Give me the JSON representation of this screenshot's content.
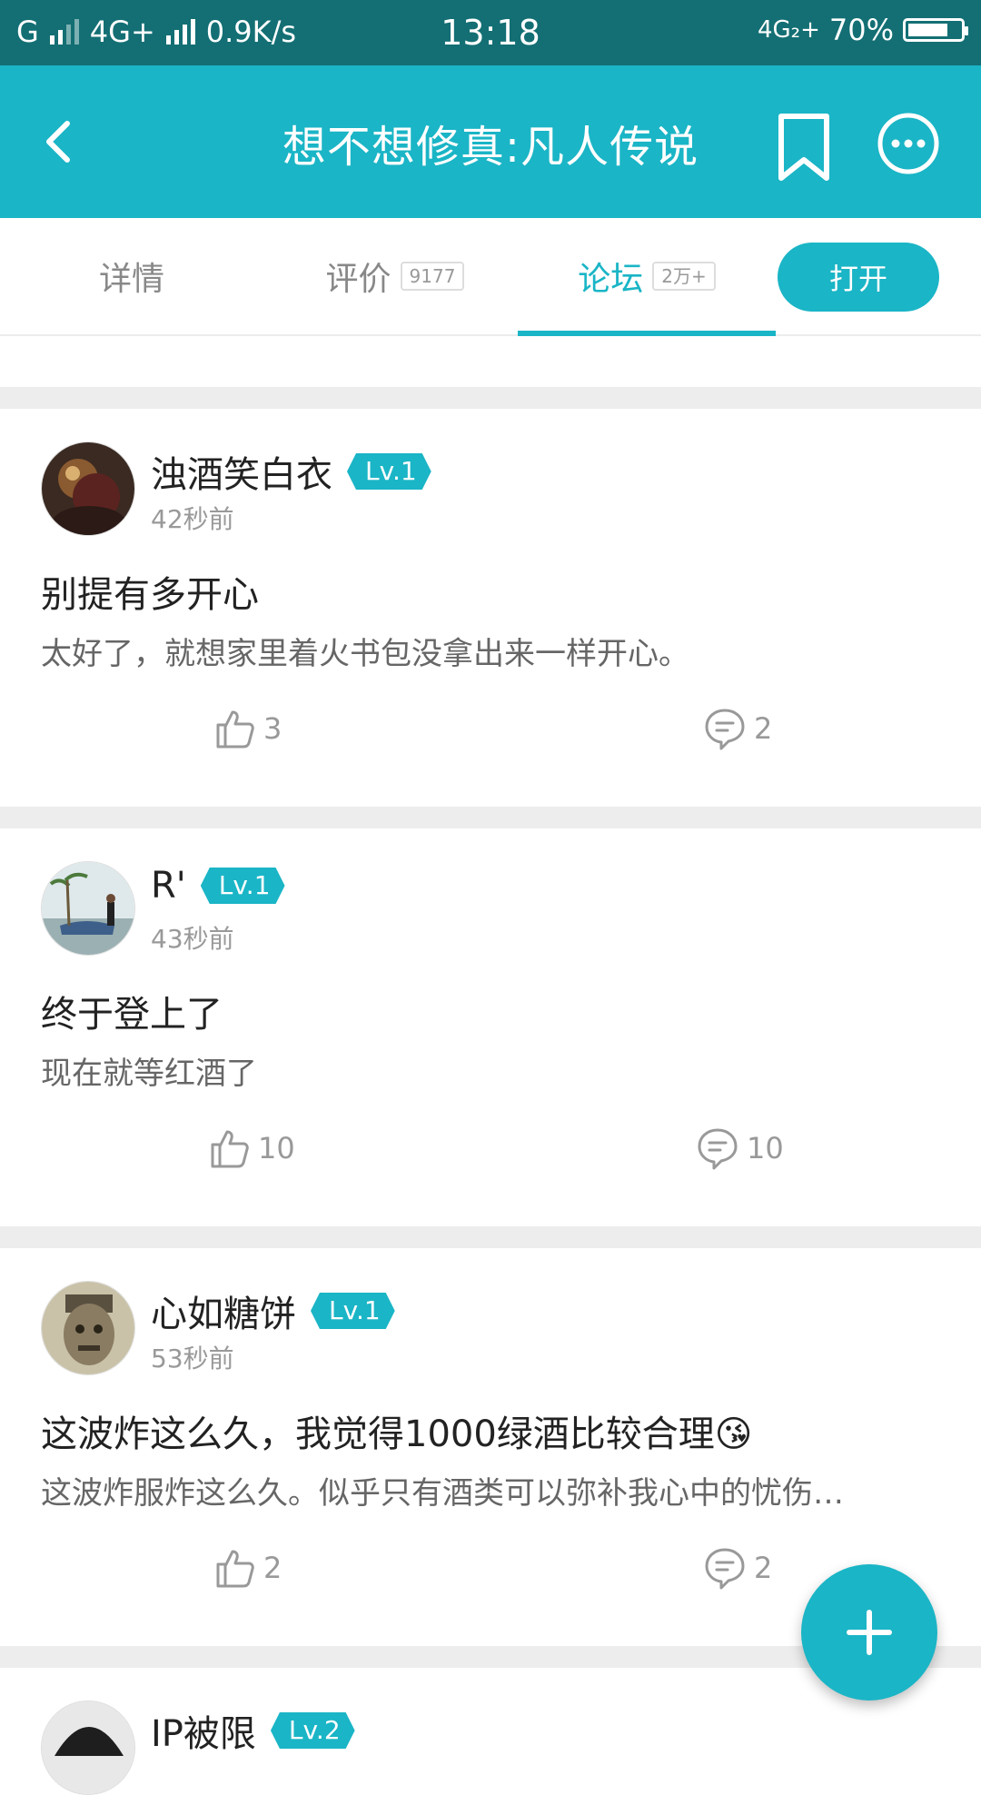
{
  "status_bar": {
    "carrier1": "G",
    "network": "4G+",
    "speed": "0.9K/s",
    "time": "13:18",
    "network2": "4G₂+",
    "battery": "70%"
  },
  "app_bar": {
    "title": "想不想修真:凡人传说",
    "back_icon": "chevron-left-icon",
    "bookmark_icon": "bookmark-icon",
    "more_icon": "more-horizontal-icon"
  },
  "tabs": [
    {
      "label": "详情",
      "badge": ""
    },
    {
      "label": "评价",
      "badge": "9177"
    },
    {
      "label": "论坛",
      "badge": "2万+",
      "active": true
    }
  ],
  "open_button": "打开",
  "posts": [
    {
      "username": "浊酒笑白衣",
      "level": "Lv.1",
      "time": "42秒前",
      "title": "别提有多开心",
      "body": "太好了，就想家里着火书包没拿出来一样开心。",
      "likes": "3",
      "comments": "2"
    },
    {
      "username": "R'",
      "level": "Lv.1",
      "time": "43秒前",
      "title": "终于登上了",
      "body": "现在就等红酒了",
      "likes": "10",
      "comments": "10"
    },
    {
      "username": "心如糖饼",
      "level": "Lv.1",
      "time": "53秒前",
      "title": "这波炸这么久，我觉得1000绿酒比较合理😘",
      "body": "这波炸服炸这么久。似乎只有酒类可以弥补我心中的忧伤…",
      "likes": "2",
      "comments": "2"
    },
    {
      "username": "IP被限",
      "level": "Lv.2"
    }
  ],
  "fab_icon": "plus-icon",
  "colors": {
    "accent": "#1ab5c6",
    "status_bar": "#136f74"
  }
}
